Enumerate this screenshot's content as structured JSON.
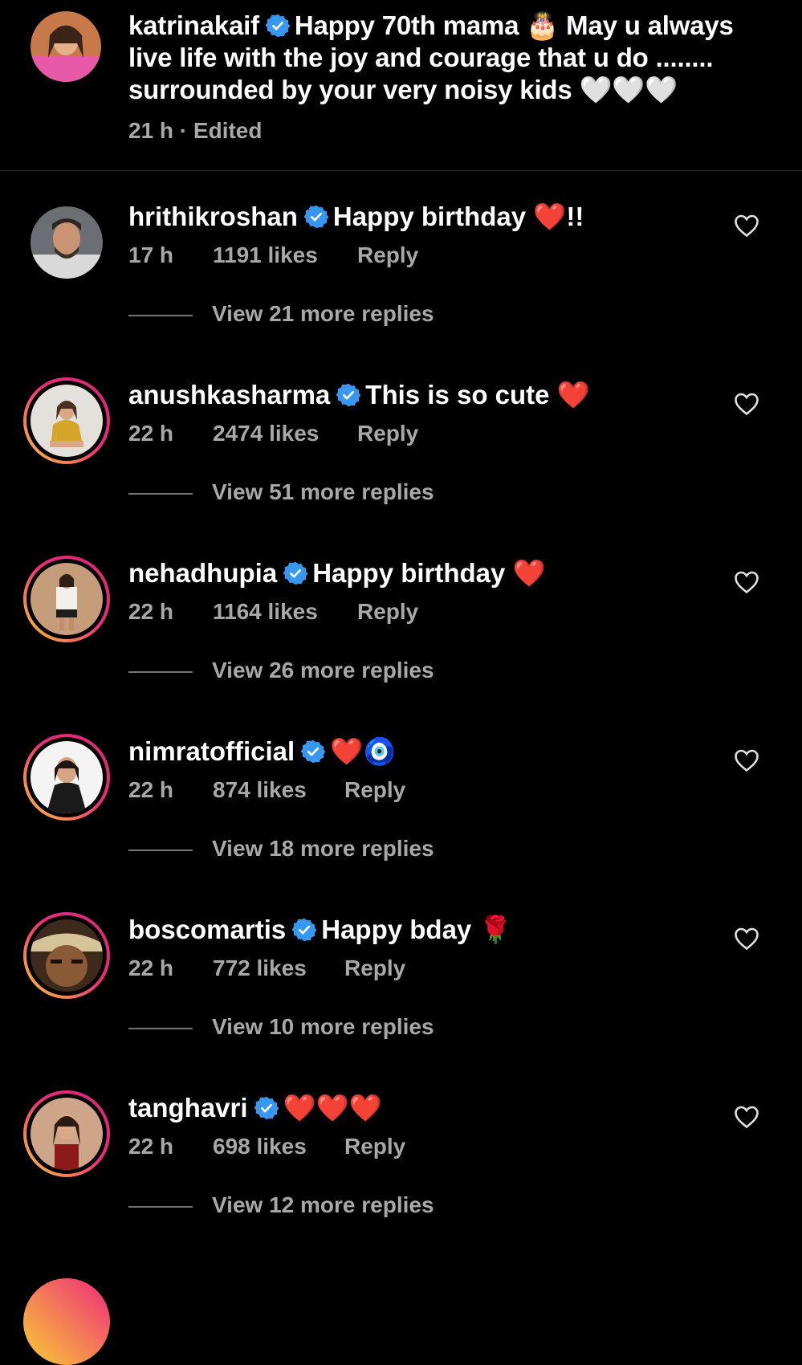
{
  "caption": {
    "username": "katrinakaif",
    "text_part1": "Happy 70th mama",
    "cake": "🎂",
    "text_part2": "May u always live life with the joy and courage that u do ........ surrounded by your very noisy kids",
    "hearts": "🤍🤍🤍",
    "time": "21 h",
    "edited": "Edited"
  },
  "comments": [
    {
      "username": "hrithikroshan",
      "text": "Happy birthday",
      "emoji": "❤️",
      "suffix": "!!",
      "time": "17 h",
      "likes": "1191 likes",
      "reply": "Reply",
      "view_replies": "View 21 more replies"
    },
    {
      "username": "anushkasharma",
      "text": "This is so cute",
      "emoji": "❤️",
      "suffix": "",
      "time": "22 h",
      "likes": "2474 likes",
      "reply": "Reply",
      "view_replies": "View 51 more replies"
    },
    {
      "username": "nehadhupia",
      "text": "Happy birthday",
      "emoji": "❤️",
      "suffix": "",
      "time": "22 h",
      "likes": "1164 likes",
      "reply": "Reply",
      "view_replies": "View 26 more replies"
    },
    {
      "username": "nimratofficial",
      "text": "",
      "emoji": "❤️🧿",
      "suffix": "",
      "time": "22 h",
      "likes": "874 likes",
      "reply": "Reply",
      "view_replies": "View 18 more replies"
    },
    {
      "username": "boscomartis",
      "text": "Happy bday",
      "emoji": "🌹",
      "suffix": "",
      "time": "22 h",
      "likes": "772 likes",
      "reply": "Reply",
      "view_replies": "View 10 more replies"
    },
    {
      "username": "tanghavri",
      "text": "",
      "emoji": "❤️❤️❤️",
      "suffix": "",
      "time": "22 h",
      "likes": "698 likes",
      "reply": "Reply",
      "view_replies": "View 12 more replies"
    }
  ],
  "colors": {
    "verified": "#3897f0",
    "heart": "#e8202e",
    "muted": "#a8a8a8"
  },
  "icons": {
    "verified": "verified-badge-icon",
    "like": "heart-outline-icon"
  }
}
